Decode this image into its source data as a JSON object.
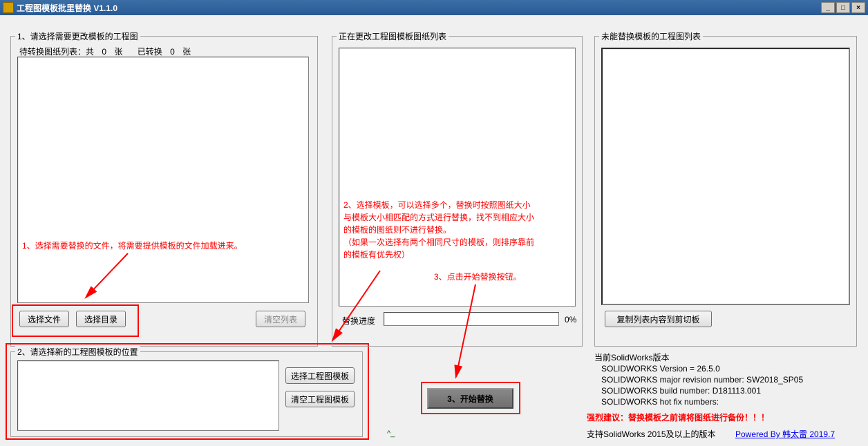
{
  "window": {
    "title": "工程图模板批里替换  V1.1.0",
    "minimize": "_",
    "maximize": "□",
    "close": "×"
  },
  "section1": {
    "label": "1、请选择需要更改模板的工程图",
    "stats_prefix": "待转换图纸列表：共",
    "total": "0",
    "unit1": "张",
    "converted_prefix": "已转换",
    "converted": "0",
    "unit2": "张",
    "btn_select_file": "选择文件",
    "btn_select_dir": "选择目录",
    "btn_clear": "清空列表"
  },
  "section2": {
    "label": "2、请选择新的工程图模板的位置",
    "btn_select_template": "选择工程图模板",
    "btn_clear_template": "清空工程图模板"
  },
  "section3": {
    "label": "正在更改工程图模板图纸列表",
    "progress_label": "替换进度",
    "progress_pct": "0%"
  },
  "section4": {
    "label": "未能替换模板的工程图列表",
    "btn_copy": "复制列表内容到剪切板"
  },
  "start_btn": "3、开始替换",
  "annotations": {
    "a1": "1、选择需要替换的文件，将需要提供模板的文件加载进来。",
    "a2_l1": "2、选择模板，可以选择多个，替换时按照图纸大小",
    "a2_l2": "与模板大小相匹配的方式进行替换，找不到相应大小",
    "a2_l3": "的模板的图纸则不进行替换。",
    "a2_l4": "（如果一次选择有两个相同尺寸的模板，则排序靠前",
    "a2_l5": "的模板有优先权）",
    "a3": "3、点击开始替换按钮。"
  },
  "info": {
    "header": "当前SolidWorks版本",
    "l1": "SOLIDWORKS Version = 26.5.0",
    "l2": "SOLIDWORKS major revision number: SW2018_SP05",
    "l3": "SOLIDWORKS build number: D181113.001",
    "l4": "SOLIDWORKS hot fix numbers:"
  },
  "warning": "强烈建议：替换模板之前请将图纸进行备份！！！",
  "support": "支持SolidWorks 2015及以上的版本",
  "powered": "Powered By 韩太雷 2019.7"
}
